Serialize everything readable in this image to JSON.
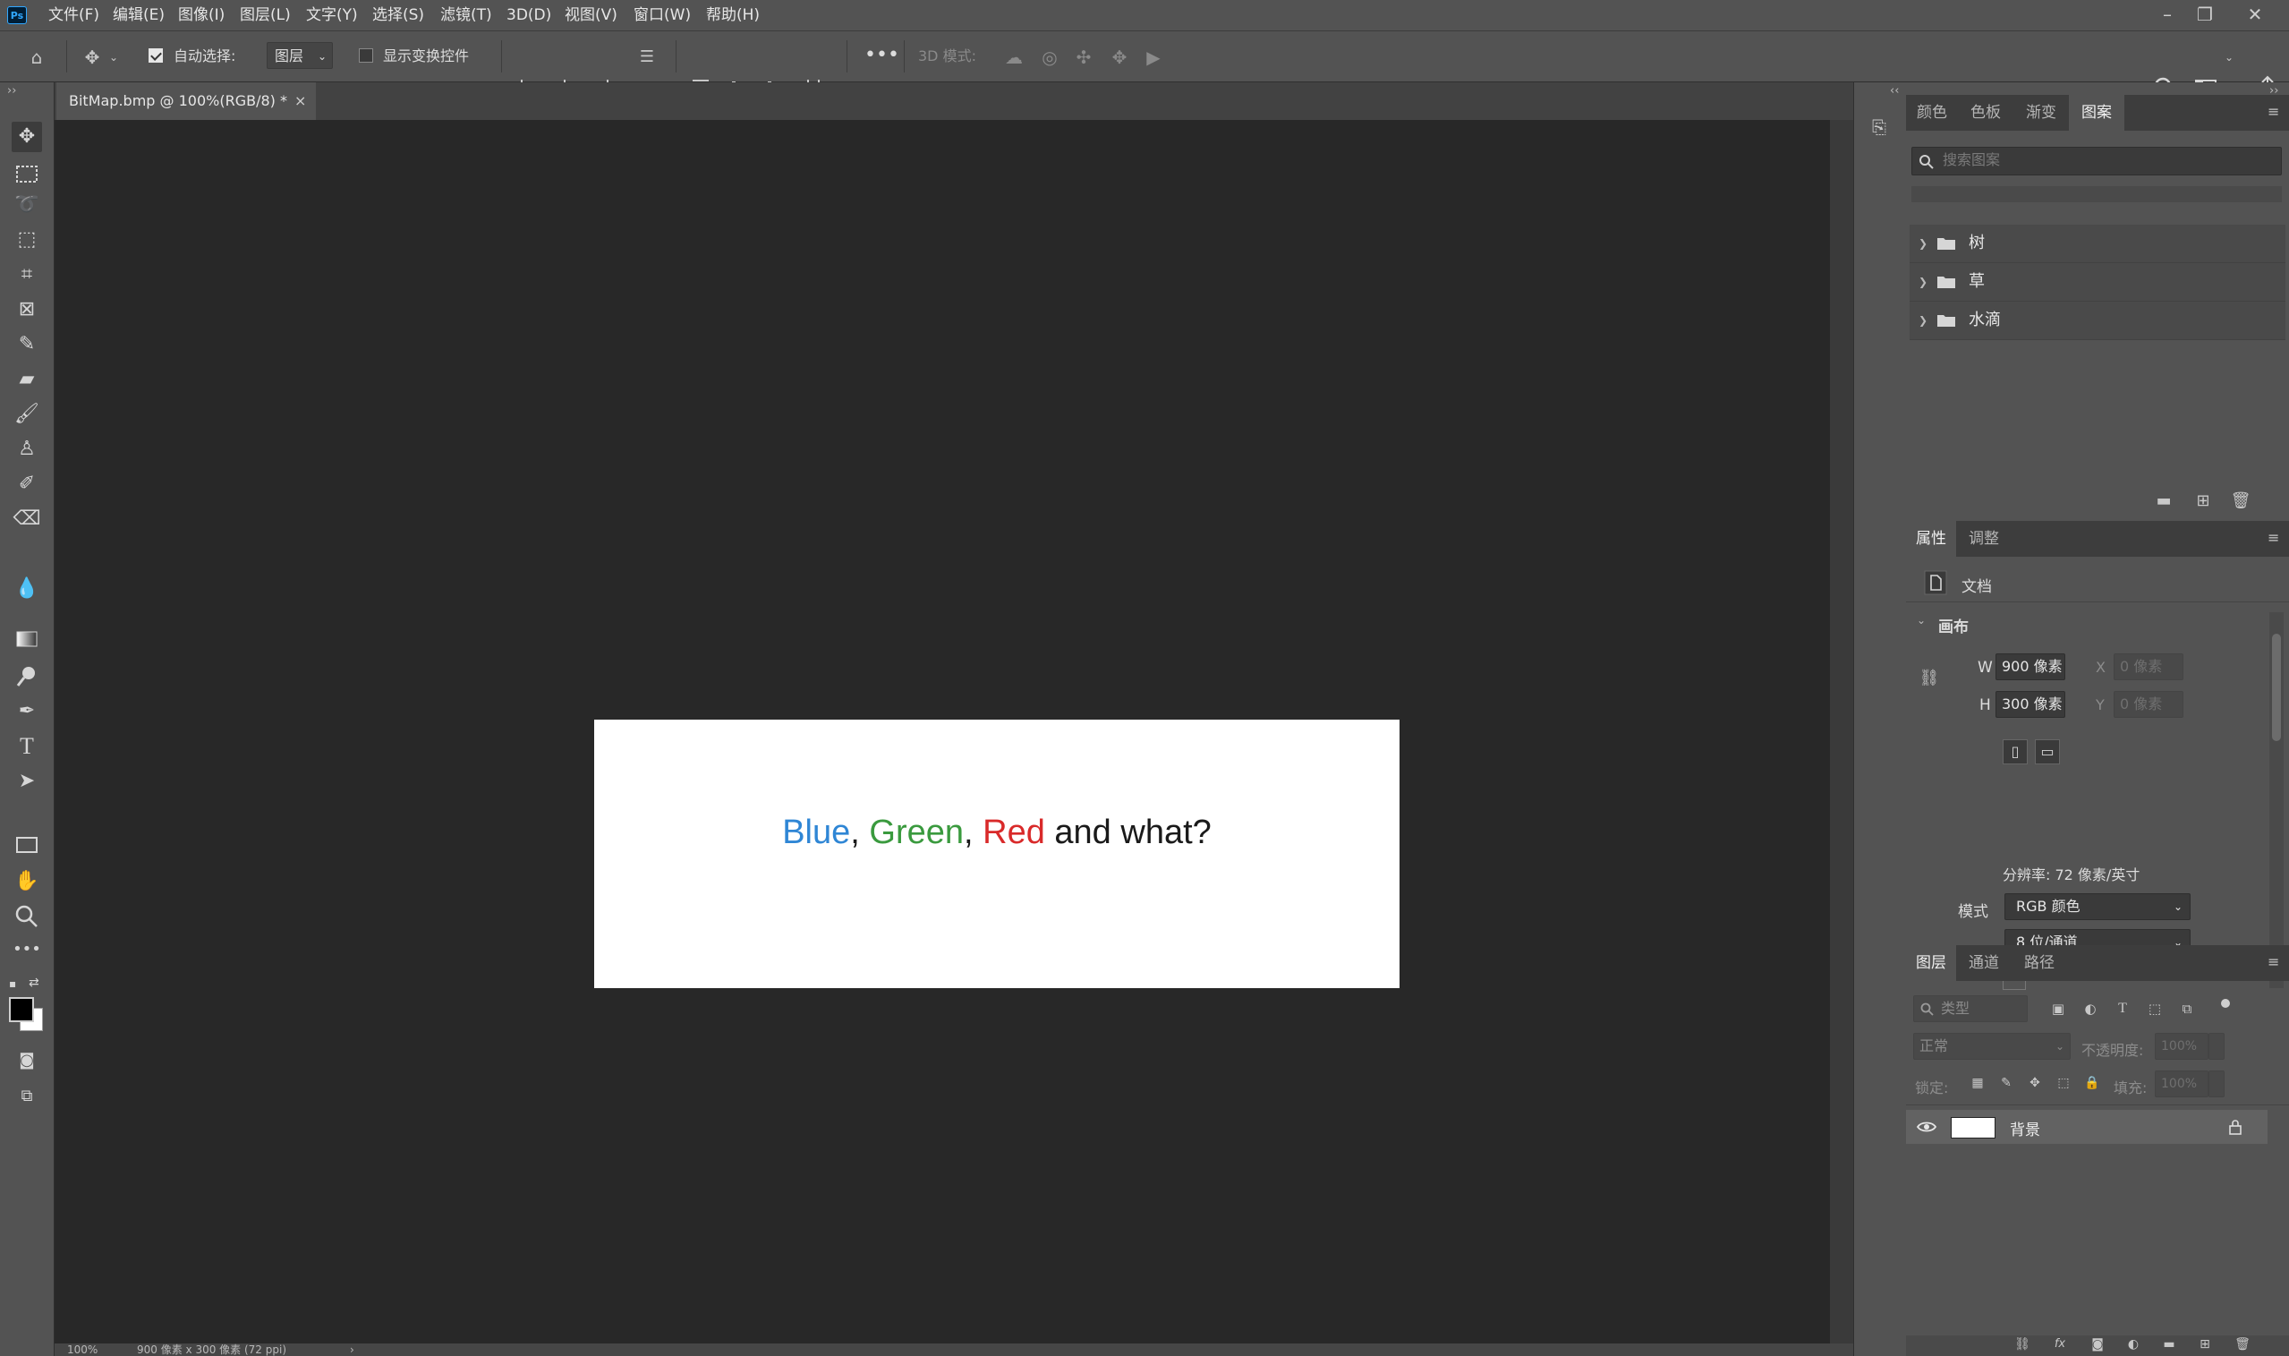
{
  "app": {
    "logo": "Ps"
  },
  "menu": [
    "文件(F)",
    "编辑(E)",
    "图像(I)",
    "图层(L)",
    "文字(Y)",
    "选择(S)",
    "滤镜(T)",
    "3D(D)",
    "视图(V)",
    "窗口(W)",
    "帮助(H)"
  ],
  "window_controls": {
    "minimize": "–",
    "restore": "❐",
    "close": "✕"
  },
  "options": {
    "auto_select_label": "自动选择:",
    "auto_select_checked": true,
    "auto_select_target": "图层",
    "show_transform_label": "显示变换控件",
    "show_transform_checked": false,
    "mode_3d_label": "3D 模式:",
    "more": "•••"
  },
  "document": {
    "tab_title": "BitMap.bmp @ 100%(RGB/8) *",
    "tab_close": "×",
    "text_parts": [
      {
        "text": "Blue",
        "color": "#2f86d5"
      },
      {
        "text": ", ",
        "color": "#1a1a1a"
      },
      {
        "text": "Green",
        "color": "#3a9a3e"
      },
      {
        "text": ", ",
        "color": "#1a1a1a"
      },
      {
        "text": "Red",
        "color": "#d92a2a"
      },
      {
        "text": " and what?",
        "color": "#1a1a1a"
      }
    ]
  },
  "status": {
    "zoom": "100%",
    "info": "900 像素 x 300 像素 (72 ppi)",
    "arrow": "›"
  },
  "patterns_panel": {
    "tabs": [
      "颜色",
      "色板",
      "渐变",
      "图案"
    ],
    "active_tab": "图案",
    "search_placeholder": "搜索图案",
    "groups": [
      "树",
      "草",
      "水滴"
    ]
  },
  "properties_panel": {
    "tabs": [
      "属性",
      "调整"
    ],
    "active_tab": "属性",
    "doc_label": "文档",
    "section": "画布",
    "w_label": "W",
    "w_value": "900 像素",
    "h_label": "H",
    "h_value": "300 像素",
    "x_label": "X",
    "x_placeholder": "0 像素",
    "y_label": "Y",
    "y_placeholder": "0 像素",
    "resolution": "分辨率: 72 像素/英寸",
    "mode_label": "模式",
    "mode_value": "RGB 颜色",
    "depth_value": "8 位/通道"
  },
  "layers_panel": {
    "tabs": [
      "图层",
      "通道",
      "路径"
    ],
    "active_tab": "图层",
    "filter_placeholder": "类型",
    "blend_mode": "正常",
    "opacity_label": "不透明度:",
    "opacity_value": "100%",
    "lock_label": "锁定:",
    "fill_label": "填充:",
    "fill_value": "100%",
    "layers": [
      {
        "name": "背景",
        "visible": true,
        "locked": true
      }
    ],
    "footer_icons": [
      "link-icon",
      "fx-icon",
      "mask-icon",
      "adjustment-icon",
      "group-icon",
      "new-layer-icon",
      "delete-icon"
    ]
  }
}
